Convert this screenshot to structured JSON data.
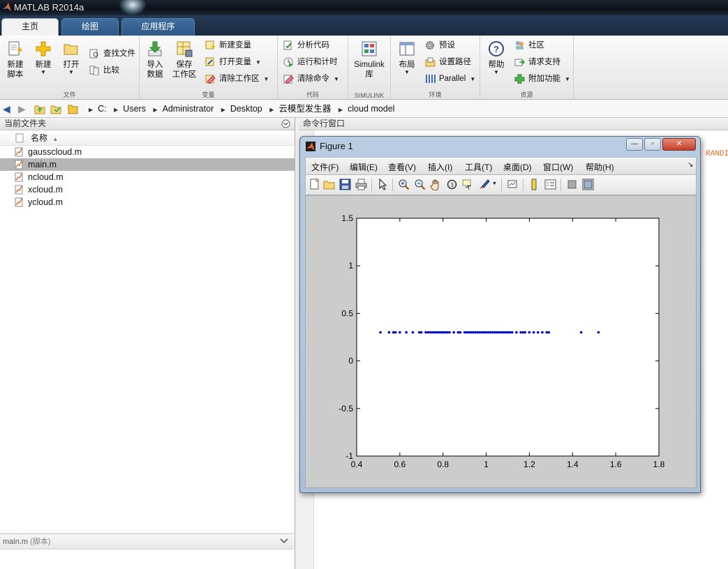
{
  "app": {
    "title": "MATLAB R2014a"
  },
  "tabs": [
    {
      "label": "主页"
    },
    {
      "label": "绘图"
    },
    {
      "label": "应用程序"
    }
  ],
  "ribbon": {
    "file": {
      "new_script": "新建\n脚本",
      "new": "新建",
      "open": "打开",
      "find_files": "查找文件",
      "compare": "比较",
      "label": "文件"
    },
    "variable": {
      "import_data": "导入\n数据",
      "save_workspace": "保存\n工作区",
      "new_variable": "新建变量",
      "open_variable": "打开变量",
      "clear_workspace": "清除工作区",
      "label": "变量"
    },
    "code": {
      "analyze_code": "分析代码",
      "run_and_time": "运行和计时",
      "clear_commands": "清除命令",
      "label": "代码"
    },
    "simulink": {
      "library": "Simulink\n库",
      "label": "SIMULINK"
    },
    "environment": {
      "layout": "布局",
      "preferences": "预设",
      "set_path": "设置路径",
      "parallel": "Parallel",
      "label": "环境"
    },
    "resources": {
      "help": "帮助",
      "community": "社区",
      "request_support": "请求支持",
      "add_ons": "附加功能",
      "label": "资源"
    }
  },
  "address": {
    "crumbs": [
      "C:",
      "Users",
      "Administrator",
      "Desktop",
      "云模型发生器",
      "cloud model"
    ]
  },
  "current_folder": {
    "title": "当前文件夹",
    "name_column": "名称",
    "files": [
      "gausscloud.m",
      "main.m",
      "ncloud.m",
      "xcloud.m",
      "ycloud.m"
    ],
    "selected_index": 1,
    "details_title": "main.m",
    "details_type": "(脚本)"
  },
  "command_window": {
    "title": "命令行窗口",
    "visible_fragment": "RANDI"
  },
  "figure": {
    "title": "Figure 1",
    "menus": [
      "文件(F)",
      "编辑(E)",
      "查看(V)",
      "插入(I)",
      "工具(T)",
      "桌面(D)",
      "窗口(W)",
      "帮助(H)"
    ]
  },
  "chart_data": {
    "type": "scatter",
    "title": "",
    "xlabel": "",
    "ylabel": "",
    "xlim": [
      0.4,
      1.8
    ],
    "ylim": [
      -1,
      1.5
    ],
    "xticks": [
      "0.4",
      "0.6",
      "0.8",
      "1",
      "1.2",
      "1.4",
      "1.6",
      "1.8"
    ],
    "yticks": [
      "-1",
      "-0.5",
      "0",
      "0.5",
      "1",
      "1.5"
    ],
    "marker_color": "#0000cc",
    "grid": false,
    "series": [
      {
        "x": [
          0.51,
          0.55,
          0.57,
          0.58,
          0.6,
          0.63,
          0.66,
          0.69,
          0.7,
          0.72,
          0.73,
          0.74,
          0.75,
          0.76,
          0.77,
          0.78,
          0.79,
          0.8,
          0.8,
          0.81,
          0.82,
          0.83,
          0.85,
          0.87,
          0.88,
          0.9,
          0.91,
          0.92,
          0.93,
          0.94,
          0.95,
          0.96,
          0.97,
          0.98,
          0.99,
          1.0,
          1.01,
          1.02,
          1.03,
          1.04,
          1.05,
          1.06,
          1.07,
          1.08,
          1.09,
          1.1,
          1.11,
          1.12,
          1.14,
          1.16,
          1.17,
          1.18,
          1.2,
          1.22,
          1.24,
          1.26,
          1.28,
          1.29,
          1.44,
          1.52
        ],
        "y": [
          0.3,
          0.3,
          0.3,
          0.3,
          0.3,
          0.3,
          0.3,
          0.3,
          0.3,
          0.3,
          0.3,
          0.3,
          0.3,
          0.3,
          0.3,
          0.3,
          0.3,
          0.3,
          0.3,
          0.3,
          0.3,
          0.3,
          0.3,
          0.3,
          0.3,
          0.3,
          0.3,
          0.3,
          0.3,
          0.3,
          0.3,
          0.3,
          0.3,
          0.3,
          0.3,
          0.3,
          0.3,
          0.3,
          0.3,
          0.3,
          0.3,
          0.3,
          0.3,
          0.3,
          0.3,
          0.3,
          0.3,
          0.3,
          0.3,
          0.3,
          0.3,
          0.3,
          0.3,
          0.3,
          0.3,
          0.3,
          0.3,
          0.3,
          0.3,
          0.3
        ]
      }
    ]
  }
}
